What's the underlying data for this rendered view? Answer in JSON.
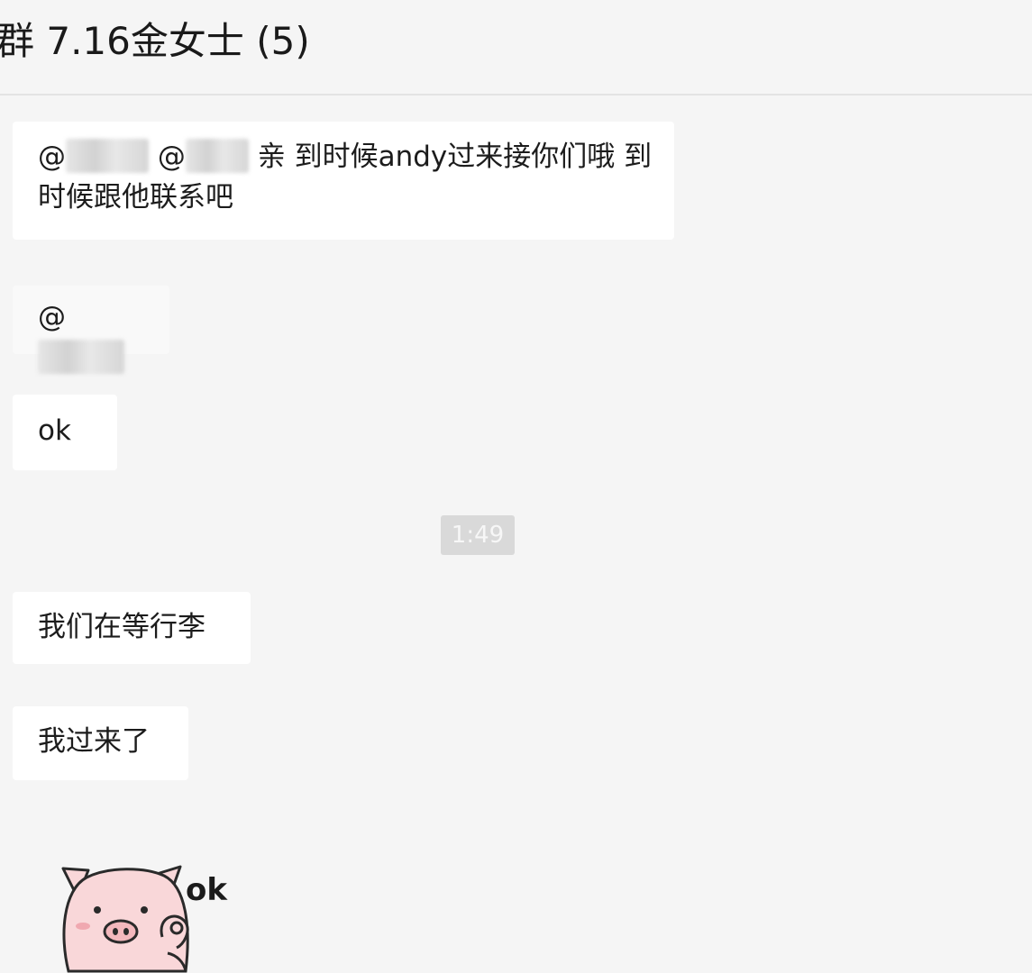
{
  "header": {
    "title": "群 7.16金女士 (5)"
  },
  "messages": [
    {
      "type": "text",
      "parts": {
        "at1": "@",
        "at2": "@",
        "rest": "亲 到时候andy过来接你们哦 到时候跟他联系吧"
      }
    },
    {
      "type": "text",
      "parts": {
        "at1": "@"
      }
    },
    {
      "type": "text",
      "text": "ok"
    },
    {
      "type": "timestamp",
      "text": "1:49"
    },
    {
      "type": "text",
      "text": "我们在等行李"
    },
    {
      "type": "text",
      "text": "我过来了"
    },
    {
      "type": "sticker",
      "icon": "pig-ok-sticker",
      "text": "ok"
    }
  ],
  "colors": {
    "background": "#f5f5f5",
    "bubble": "#ffffff",
    "timestamp_bg": "#d9d9d9",
    "sticker_pig": "#f9d7d9"
  }
}
